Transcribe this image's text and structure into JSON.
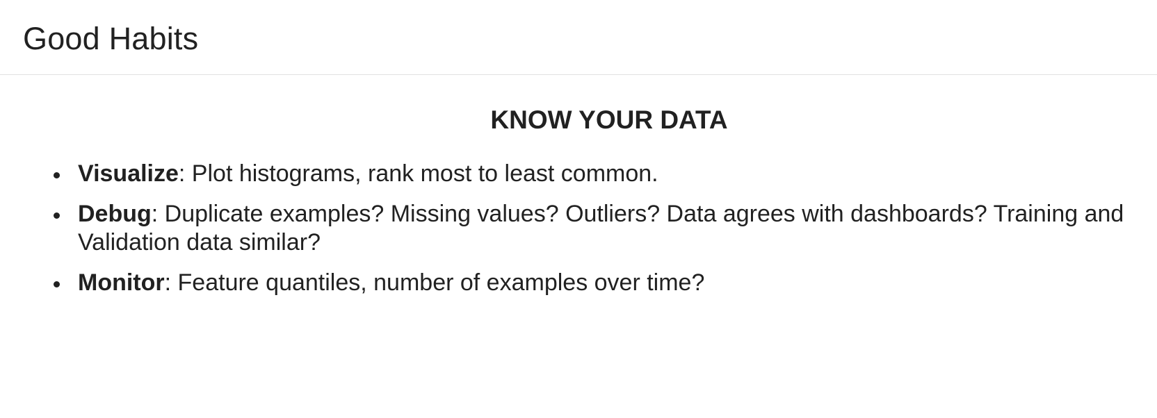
{
  "header": {
    "title": "Good Habits"
  },
  "section": {
    "heading": "KNOW YOUR DATA",
    "items": [
      {
        "term": "Visualize",
        "text": ": Plot histograms, rank most to least common."
      },
      {
        "term": "Debug",
        "text": ": Duplicate examples? Missing values? Outliers? Data agrees with dashboards? Training and Validation data similar?"
      },
      {
        "term": "Monitor",
        "text": ": Feature quantiles, number of examples over time?"
      }
    ]
  }
}
